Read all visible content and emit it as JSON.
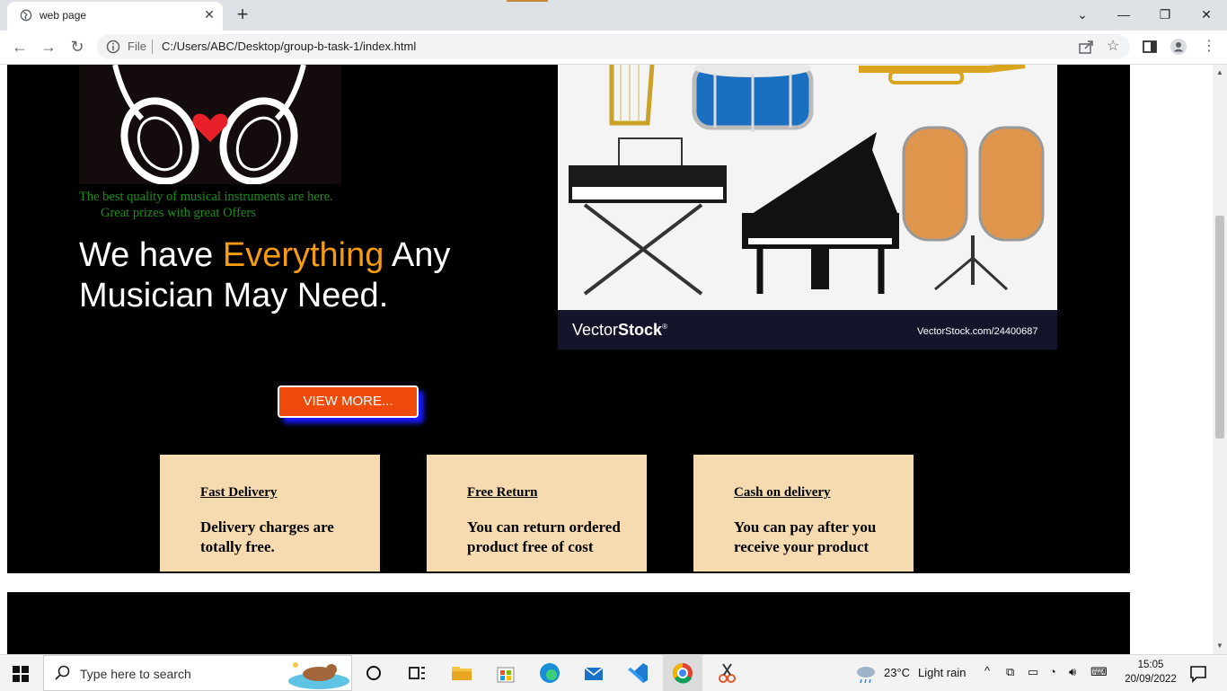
{
  "browser": {
    "tab_title": "web page",
    "omnibox_scheme": "File",
    "url": "C:/Users/ABC/Desktop/group-b-task-1/index.html"
  },
  "page": {
    "tagline_line1": "The best quality of musical instruments are here.",
    "tagline_line2": "Great prizes with great Offers",
    "headline_part1": "We have ",
    "headline_accent": "Everything",
    "headline_part2": " Any Musician May Need.",
    "view_more_label": "VIEW MORE...",
    "image_brand_light": "Vector",
    "image_brand_bold": "Stock",
    "image_brand_reg": "®",
    "image_id": "VectorStock.com/24400687",
    "features": [
      {
        "title": "Fast Delivery",
        "desc": "Delivery charges are totally free."
      },
      {
        "title": "Free Return",
        "desc": "You can return ordered product free of cost"
      },
      {
        "title": "Cash on delivery",
        "desc": "You can pay after you receive your product"
      }
    ]
  },
  "taskbar": {
    "search_placeholder": "Type here to search",
    "weather_temp": "23°C",
    "weather_desc": "Light rain",
    "time": "15:05",
    "date": "20/09/2022"
  },
  "colors": {
    "accent_orange": "#f39c12",
    "button_red": "#f04a0a",
    "tagline_green": "#1a8d1a",
    "card_bg": "#f6dbb0"
  }
}
